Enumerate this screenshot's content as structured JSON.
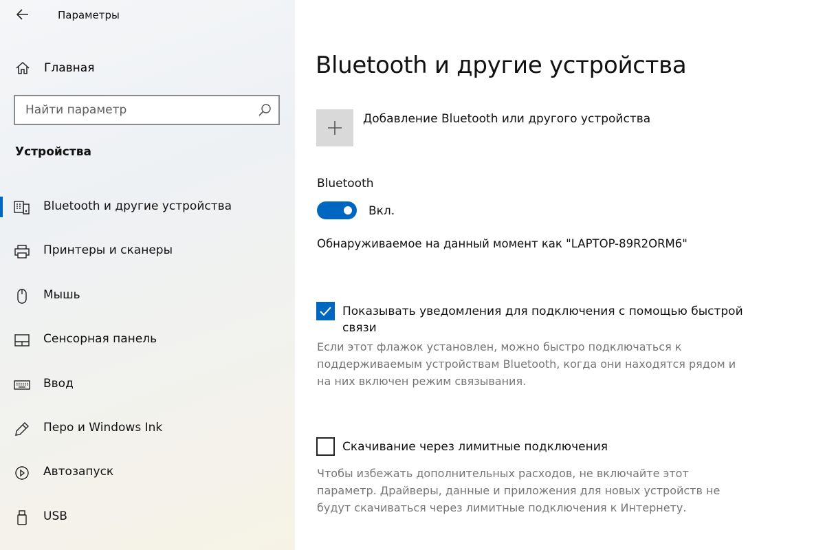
{
  "window": {
    "title": "Параметры"
  },
  "sidebar": {
    "home_label": "Главная",
    "search_placeholder": "Найти параметр",
    "section_title": "Устройства",
    "items": [
      {
        "label": "Bluetooth и другие устройства",
        "icon": "bluetooth-devices-icon",
        "selected": true
      },
      {
        "label": "Принтеры и сканеры",
        "icon": "printer-icon",
        "selected": false
      },
      {
        "label": "Мышь",
        "icon": "mouse-icon",
        "selected": false
      },
      {
        "label": "Сенсорная панель",
        "icon": "touchpad-icon",
        "selected": false
      },
      {
        "label": "Ввод",
        "icon": "keyboard-icon",
        "selected": false
      },
      {
        "label": "Перо и Windows Ink",
        "icon": "pen-icon",
        "selected": false
      },
      {
        "label": "Автозапуск",
        "icon": "autoplay-icon",
        "selected": false
      },
      {
        "label": "USB",
        "icon": "usb-icon",
        "selected": false
      }
    ]
  },
  "main": {
    "page_title": "Bluetooth и другие устройства",
    "add_device_label": "Добавление Bluetooth или другого устройства",
    "bluetooth_label": "Bluetooth",
    "bluetooth_state": "Вкл.",
    "bluetooth_on": true,
    "discoverable_text": "Обнаруживаемое на данный момент как \"LAPTOP-89R2ORM6\"",
    "swift_pair": {
      "label": "Показывать уведомления для подключения с помощью быстрой связи",
      "checked": true,
      "description": "Если этот флажок установлен, можно быстро подключаться к поддерживаемым устройствам Bluetooth, когда они находятся рядом и на них включен режим связывания."
    },
    "metered": {
      "label": "Скачивание через лимитные подключения",
      "checked": false,
      "description": "Чтобы избежать дополнительных расходов, не включайте этот параметр. Драйверы, данные и приложения для новых устройств не будут скачиваться через лимитные подключения к Интернету."
    }
  },
  "colors": {
    "accent": "#0067c0",
    "secondary_text": "#767676",
    "tile": "#d9d9d9"
  }
}
